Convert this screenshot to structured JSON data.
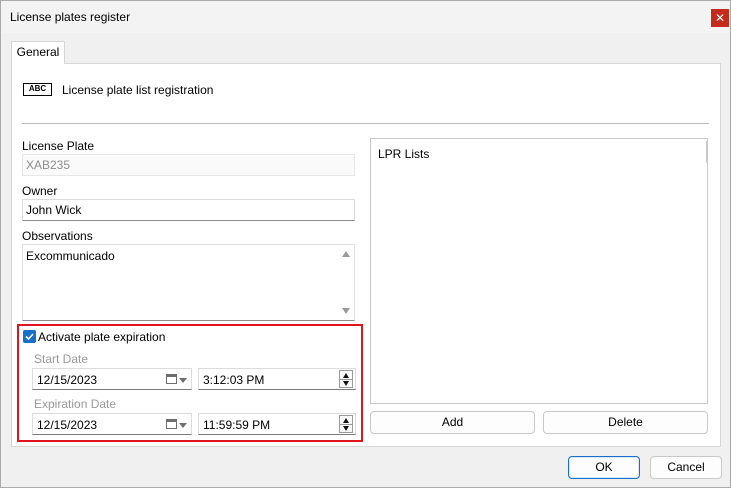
{
  "window": {
    "title": "License plates register",
    "close_icon": "✕"
  },
  "tabs": [
    {
      "label": "General"
    }
  ],
  "header": {
    "badge": "ABC",
    "text": "License plate list registration"
  },
  "form": {
    "license_plate": {
      "label": "License Plate",
      "value": "XAB235"
    },
    "owner": {
      "label": "Owner",
      "value": "John Wick"
    },
    "observations": {
      "label": "Observations",
      "value": "Excommunicado"
    }
  },
  "expiration": {
    "checkbox_label": "Activate plate expiration",
    "checked": true,
    "start": {
      "label": "Start Date",
      "date": "12/15/2023",
      "time": "3:12:03 PM"
    },
    "end": {
      "label": "Expiration Date",
      "date": "12/15/2023",
      "time": "11:59:59 PM"
    }
  },
  "lpr": {
    "header": "LPR Lists",
    "add_label": "Add",
    "delete_label": "Delete"
  },
  "footer": {
    "ok_label": "OK",
    "cancel_label": "Cancel"
  },
  "colors": {
    "accent": "#1570c8",
    "highlight": "#e0141c",
    "close": "#c42b1c"
  }
}
